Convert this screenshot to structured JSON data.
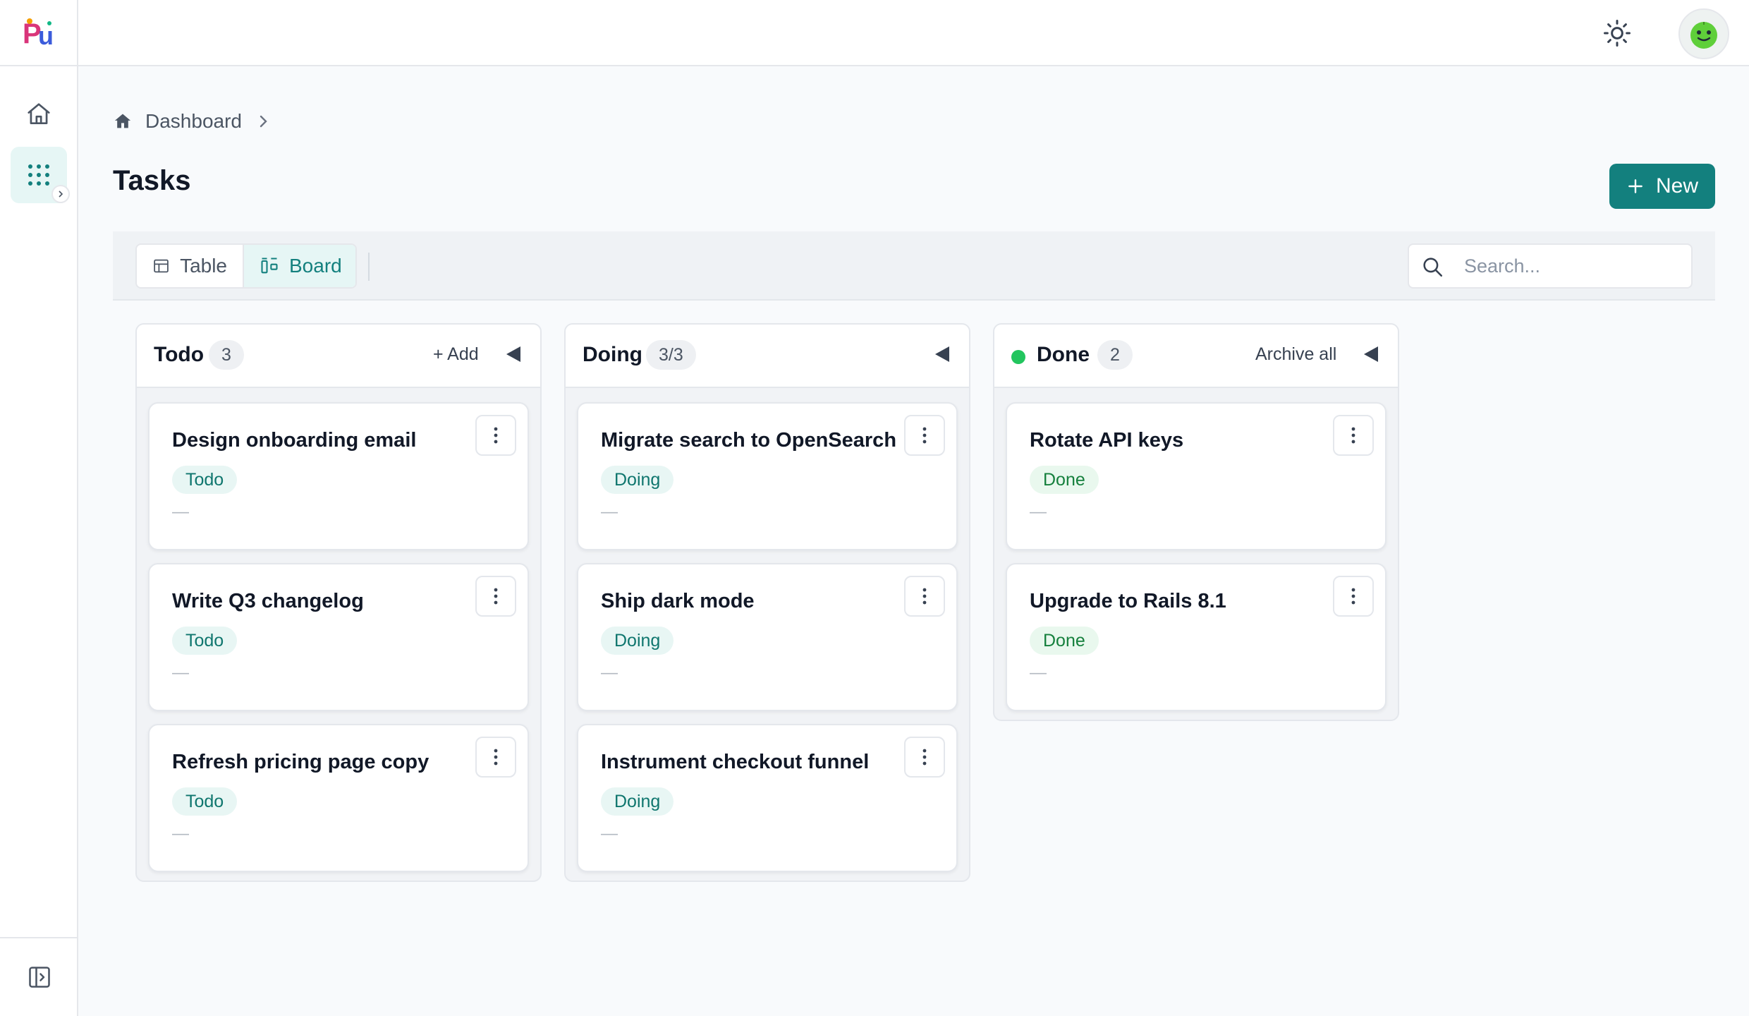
{
  "app": {
    "logo_text": "Pu"
  },
  "breadcrumb": {
    "label": "Dashboard"
  },
  "page": {
    "title": "Tasks",
    "new_label": "New"
  },
  "views": {
    "table_label": "Table",
    "board_label": "Board",
    "active": "Board"
  },
  "search": {
    "placeholder": "Search...",
    "value": ""
  },
  "colors": {
    "primary": "#13807e",
    "done_dot": "#22c55e",
    "tag_todo_bg": "#e8f6f4",
    "tag_done_bg": "#e9f8ee"
  },
  "icons": {
    "sidebar": [
      "home-icon",
      "apps-grid-icon",
      "sidebar-expand-icon"
    ],
    "header": [
      "sun-icon",
      "avatar"
    ],
    "card_menu": "more-vertical-icon"
  },
  "columns": [
    {
      "title": "Todo",
      "count": "3",
      "action": "+ Add",
      "cards": [
        {
          "title": "Design onboarding email",
          "status": "Todo",
          "meta": "—"
        },
        {
          "title": "Write Q3 changelog",
          "status": "Todo",
          "meta": "—"
        },
        {
          "title": "Refresh pricing page copy",
          "status": "Todo",
          "meta": "—"
        }
      ]
    },
    {
      "title": "Doing",
      "count": "3/3",
      "action": "",
      "cards": [
        {
          "title": "Migrate search to OpenSearch",
          "status": "Doing",
          "meta": "—"
        },
        {
          "title": "Ship dark mode",
          "status": "Doing",
          "meta": "—"
        },
        {
          "title": "Instrument checkout funnel",
          "status": "Doing",
          "meta": "—"
        }
      ]
    },
    {
      "title": "Done",
      "count": "2",
      "action": "Archive all",
      "cards": [
        {
          "title": "Rotate API keys",
          "status": "Done",
          "meta": "—"
        },
        {
          "title": "Upgrade to Rails 8.1",
          "status": "Done",
          "meta": "—"
        }
      ]
    }
  ]
}
